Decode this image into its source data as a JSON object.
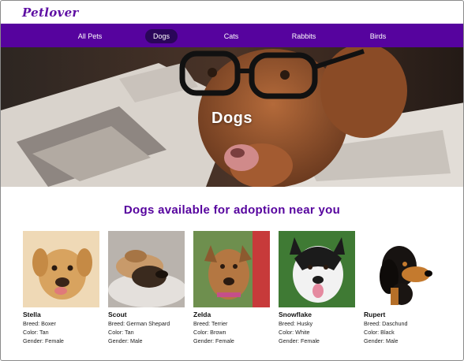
{
  "brand": {
    "logo": "Petlover"
  },
  "nav": {
    "items": [
      {
        "label": "All Pets",
        "active": false
      },
      {
        "label": "Dogs",
        "active": true
      },
      {
        "label": "Cats",
        "active": false
      },
      {
        "label": "Rabbits",
        "active": false
      },
      {
        "label": "Birds",
        "active": false
      }
    ]
  },
  "hero": {
    "title": "Dogs"
  },
  "listing": {
    "heading": "Dogs available for adoption near you",
    "dogs": [
      {
        "name": "Stella",
        "breed": "Breed: Boxer",
        "color": "Color: Tan",
        "gender": "Gender: Female"
      },
      {
        "name": "Scout",
        "breed": "Breed: German Shepard",
        "color": "Color: Tan",
        "gender": "Gender: Male"
      },
      {
        "name": "Zelda",
        "breed": "Breed: Terrier",
        "color": "Color: Brown",
        "gender": "Gender: Female"
      },
      {
        "name": "Snowflake",
        "breed": "Breed: Husky",
        "color": "Color: White",
        "gender": "Gender: Female"
      },
      {
        "name": "Rupert",
        "breed": "Breed: Daschund",
        "color": "Color: Black",
        "gender": "Gender: Male"
      }
    ]
  },
  "colors": {
    "brand_purple": "#56039e",
    "active_pill": "#2a0659",
    "heading_purple": "#56039e"
  }
}
